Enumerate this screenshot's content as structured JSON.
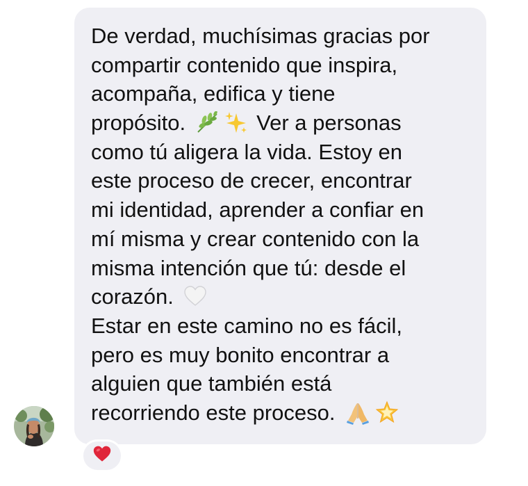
{
  "message": {
    "lines": [
      "De verdad, muchísimas gracias por",
      "compartir contenido que inspira,",
      "acompaña, edifica y tiene",
      "propósito.",
      "Ver a personas",
      "como tú aligera la vida. Estoy en",
      "este proceso de crecer, encontrar",
      "mi identidad, aprender a confiar en",
      "mí misma y crear contenido con la",
      "misma intención que tú: desde el",
      "corazón.",
      "Estar en este camino no es fácil,",
      "pero es muy bonito encontrar a",
      "alguien que también está",
      "recorriendo este proceso."
    ],
    "emojis": {
      "line4": [
        "herb-icon",
        "sparkles-icon"
      ],
      "line11": [
        "white-heart-icon"
      ],
      "line15": [
        "folded-hands-icon",
        "glowing-star-icon"
      ]
    }
  },
  "reaction": {
    "emoji": "red-heart-icon",
    "color": "#e0263a"
  },
  "sender": {
    "avatar": "avatar"
  },
  "colors": {
    "bubble": "#efeff4",
    "text": "#111111",
    "background": "#ffffff"
  }
}
